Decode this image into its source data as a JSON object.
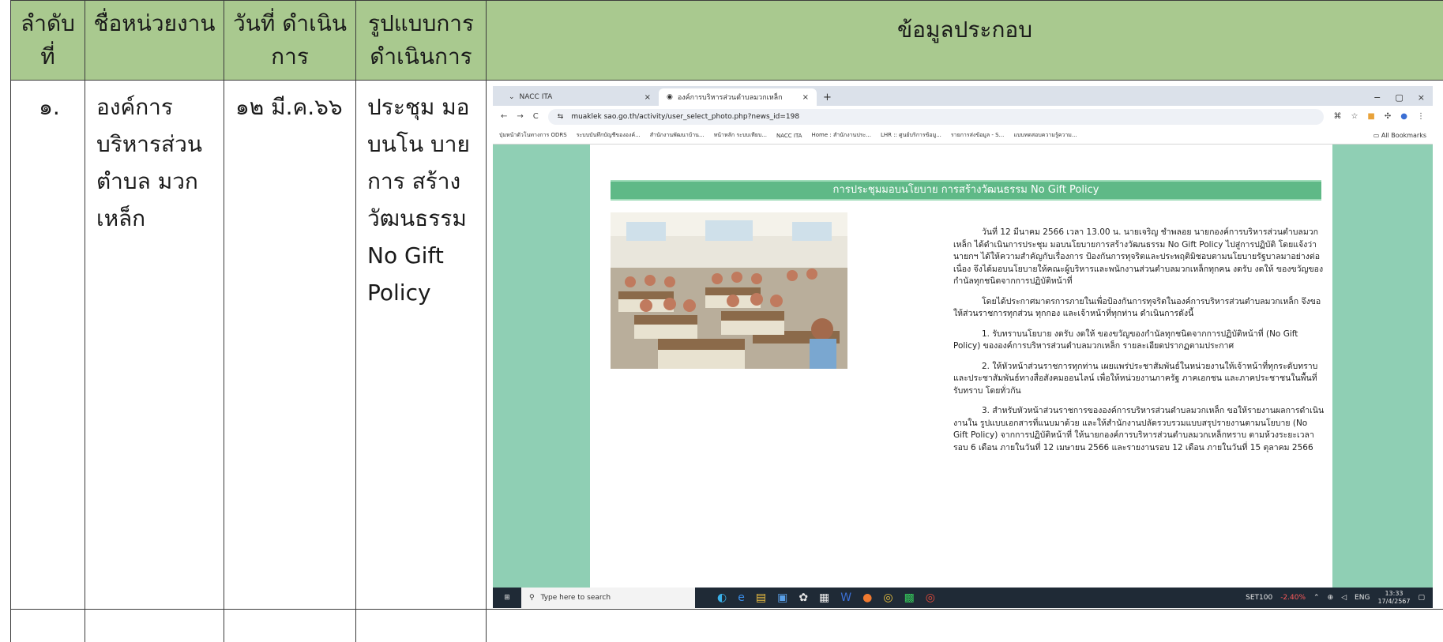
{
  "table": {
    "headers": {
      "order": "ลำดับ ที่",
      "agency": "ชื่อหน่วยงาน",
      "date": "วันที่ ดำเนินการ",
      "format": "รูปแบบการ ดำเนินการ",
      "info": "ข้อมูลประกอบ"
    },
    "row": {
      "order": "๑.",
      "agency": "องค์การ บริหารส่วน ตำบล มวกเหล็ก",
      "date": "๑๒ มี.ค.๖๖",
      "format": "ประชุม มอบนโน บายการ สร้าง วัฒนธรรม No Gift Policy"
    }
  },
  "browser": {
    "tabs": [
      {
        "label": "NACC ITA",
        "close": "×"
      },
      {
        "label": "องค์การบริหารส่วนตำบลมวกเหล็ก",
        "close": "×"
      }
    ],
    "new_tab": "+",
    "win": {
      "min": "−",
      "max": "▢",
      "close": "×"
    },
    "nav": {
      "back": "←",
      "forward": "→",
      "reload": "C",
      "site_info": "⇆"
    },
    "url": "muaklek sao.go.th/activity/user_select_photo.php?news_id=198",
    "bookmarks": [
      "ปุ่มหน้าตัวโนทางการ ODRS",
      "ระบบบันทึกบัญชีขององค์...",
      "สำนักงานพัฒนาบ้าน...",
      "หน้าหลัก ระบบเทียบ...",
      "NACC ITA",
      "Home : สำนักงานประ...",
      "LHR :: ศูนย์บริการข้อมู...",
      "รายการส่งข้อมูล - S...",
      "แบบทดสอบความรู้ความ..."
    ],
    "all_bookmarks": "All Bookmarks",
    "article": {
      "title": "การประชุมมอบนโยบาย การสร้างวัฒนธรรม No Gift Policy",
      "paragraphs": [
        "วันที่ 12 มีนาคม 2566 เวลา 13.00 น. นายเจริญ ชำพลอย นายกองค์การบริหารส่วนตำบลมวกเหล็ก ได้ดำเนินการประชุม มอบนโยบายการสร้างวัฒนธรรม No Gift Policy ไปสู่การปฏิบัติ โดยแจ้งว่านายกฯ ได้ให้ความสำคัญกับเรื่องการ ป้องกันการทุจริตและประพฤติมิชอบตามนโยบายรัฐบาลมาอย่างต่อเนื่อง จึงได้มอบนโยบายให้คณะผู้บริหารและพนักงานส่วนตำบลมวกเหล็กทุกคน งดรับ งดให้ ของขวัญของกำนัลทุกชนิดจากการปฏิบัติหน้าที่",
        "โดยได้ประกาศมาตรการภายในเพื่อป้องกันการทุจริตในองค์การบริหารส่วนตำบลมวกเหล็ก จึงขอให้ส่วนราชการทุกส่วน ทุกกอง และเจ้าหน้าที่ทุกท่าน ดำเนินการดังนี้",
        "1. รับทราบนโยบาย งดรับ งดให้ ของขวัญของกำนัลทุกชนิดจากการปฏิบัติหน้าที่ (No Gift Policy) ขององค์การบริหารส่วนตำบลมวกเหล็ก รายละเอียดปรากฏตามประกาศ",
        "2. ให้หัวหน้าส่วนราชการทุกท่าน เผยแพร่ประชาสัมพันธ์ในหน่วยงานให้เจ้าหน้าที่ทุกระดับทราบ และประชาสัมพันธ์ทางสื่อสังคมออนไลน์ เพื่อให้หน่วยงานภาครัฐ ภาคเอกชน และภาคประชาชนในพื้นที่รับทราบ โดยทั่วกัน",
        "3. สำหรับหัวหน้าส่วนราชการขององค์การบริหารส่วนตำบลมวกเหล็ก ขอให้รายงานผลการดำเนินงานใน รูปแบบเอกสารที่แนบมาด้วย และให้สำนักงานปลัดรวบรวมแบบสรุปรายงานตามนโยบาย (No Gift Policy) จากการปฏิบัติหน้าที่ ให้นายกองค์การบริหารส่วนตำบลมวกเหล็กทราบ ตามห้วงระยะเวลารอบ 6 เดือน ภายในวันที่ 12 เมษายน 2566 และรายงานรอบ 12 เดือน ภายในวันที่ 15 ตุลาคม 2566"
      ]
    },
    "taskbar": {
      "search_placeholder": "Type here to search",
      "ticker": "SET100",
      "ticker_change": "-2.40%",
      "lang": "ENG",
      "time": "13:33",
      "date": "17/4/2567"
    }
  }
}
